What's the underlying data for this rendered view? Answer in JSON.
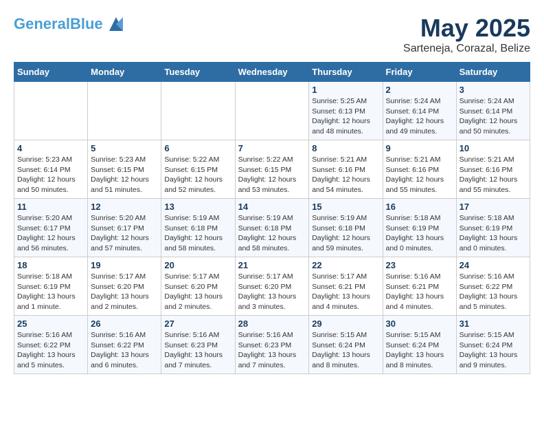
{
  "header": {
    "logo_line1": "General",
    "logo_line2": "Blue",
    "month": "May 2025",
    "location": "Sarteneja, Corazal, Belize"
  },
  "days_of_week": [
    "Sunday",
    "Monday",
    "Tuesday",
    "Wednesday",
    "Thursday",
    "Friday",
    "Saturday"
  ],
  "weeks": [
    [
      {
        "day": "",
        "info": ""
      },
      {
        "day": "",
        "info": ""
      },
      {
        "day": "",
        "info": ""
      },
      {
        "day": "",
        "info": ""
      },
      {
        "day": "1",
        "info": "Sunrise: 5:25 AM\nSunset: 6:13 PM\nDaylight: 12 hours\nand 48 minutes."
      },
      {
        "day": "2",
        "info": "Sunrise: 5:24 AM\nSunset: 6:14 PM\nDaylight: 12 hours\nand 49 minutes."
      },
      {
        "day": "3",
        "info": "Sunrise: 5:24 AM\nSunset: 6:14 PM\nDaylight: 12 hours\nand 50 minutes."
      }
    ],
    [
      {
        "day": "4",
        "info": "Sunrise: 5:23 AM\nSunset: 6:14 PM\nDaylight: 12 hours\nand 50 minutes."
      },
      {
        "day": "5",
        "info": "Sunrise: 5:23 AM\nSunset: 6:15 PM\nDaylight: 12 hours\nand 51 minutes."
      },
      {
        "day": "6",
        "info": "Sunrise: 5:22 AM\nSunset: 6:15 PM\nDaylight: 12 hours\nand 52 minutes."
      },
      {
        "day": "7",
        "info": "Sunrise: 5:22 AM\nSunset: 6:15 PM\nDaylight: 12 hours\nand 53 minutes."
      },
      {
        "day": "8",
        "info": "Sunrise: 5:21 AM\nSunset: 6:16 PM\nDaylight: 12 hours\nand 54 minutes."
      },
      {
        "day": "9",
        "info": "Sunrise: 5:21 AM\nSunset: 6:16 PM\nDaylight: 12 hours\nand 55 minutes."
      },
      {
        "day": "10",
        "info": "Sunrise: 5:21 AM\nSunset: 6:16 PM\nDaylight: 12 hours\nand 55 minutes."
      }
    ],
    [
      {
        "day": "11",
        "info": "Sunrise: 5:20 AM\nSunset: 6:17 PM\nDaylight: 12 hours\nand 56 minutes."
      },
      {
        "day": "12",
        "info": "Sunrise: 5:20 AM\nSunset: 6:17 PM\nDaylight: 12 hours\nand 57 minutes."
      },
      {
        "day": "13",
        "info": "Sunrise: 5:19 AM\nSunset: 6:18 PM\nDaylight: 12 hours\nand 58 minutes."
      },
      {
        "day": "14",
        "info": "Sunrise: 5:19 AM\nSunset: 6:18 PM\nDaylight: 12 hours\nand 58 minutes."
      },
      {
        "day": "15",
        "info": "Sunrise: 5:19 AM\nSunset: 6:18 PM\nDaylight: 12 hours\nand 59 minutes."
      },
      {
        "day": "16",
        "info": "Sunrise: 5:18 AM\nSunset: 6:19 PM\nDaylight: 13 hours\nand 0 minutes."
      },
      {
        "day": "17",
        "info": "Sunrise: 5:18 AM\nSunset: 6:19 PM\nDaylight: 13 hours\nand 0 minutes."
      }
    ],
    [
      {
        "day": "18",
        "info": "Sunrise: 5:18 AM\nSunset: 6:19 PM\nDaylight: 13 hours\nand 1 minute."
      },
      {
        "day": "19",
        "info": "Sunrise: 5:17 AM\nSunset: 6:20 PM\nDaylight: 13 hours\nand 2 minutes."
      },
      {
        "day": "20",
        "info": "Sunrise: 5:17 AM\nSunset: 6:20 PM\nDaylight: 13 hours\nand 2 minutes."
      },
      {
        "day": "21",
        "info": "Sunrise: 5:17 AM\nSunset: 6:20 PM\nDaylight: 13 hours\nand 3 minutes."
      },
      {
        "day": "22",
        "info": "Sunrise: 5:17 AM\nSunset: 6:21 PM\nDaylight: 13 hours\nand 4 minutes."
      },
      {
        "day": "23",
        "info": "Sunrise: 5:16 AM\nSunset: 6:21 PM\nDaylight: 13 hours\nand 4 minutes."
      },
      {
        "day": "24",
        "info": "Sunrise: 5:16 AM\nSunset: 6:22 PM\nDaylight: 13 hours\nand 5 minutes."
      }
    ],
    [
      {
        "day": "25",
        "info": "Sunrise: 5:16 AM\nSunset: 6:22 PM\nDaylight: 13 hours\nand 5 minutes."
      },
      {
        "day": "26",
        "info": "Sunrise: 5:16 AM\nSunset: 6:22 PM\nDaylight: 13 hours\nand 6 minutes."
      },
      {
        "day": "27",
        "info": "Sunrise: 5:16 AM\nSunset: 6:23 PM\nDaylight: 13 hours\nand 7 minutes."
      },
      {
        "day": "28",
        "info": "Sunrise: 5:16 AM\nSunset: 6:23 PM\nDaylight: 13 hours\nand 7 minutes."
      },
      {
        "day": "29",
        "info": "Sunrise: 5:15 AM\nSunset: 6:24 PM\nDaylight: 13 hours\nand 8 minutes."
      },
      {
        "day": "30",
        "info": "Sunrise: 5:15 AM\nSunset: 6:24 PM\nDaylight: 13 hours\nand 8 minutes."
      },
      {
        "day": "31",
        "info": "Sunrise: 5:15 AM\nSunset: 6:24 PM\nDaylight: 13 hours\nand 9 minutes."
      }
    ]
  ]
}
